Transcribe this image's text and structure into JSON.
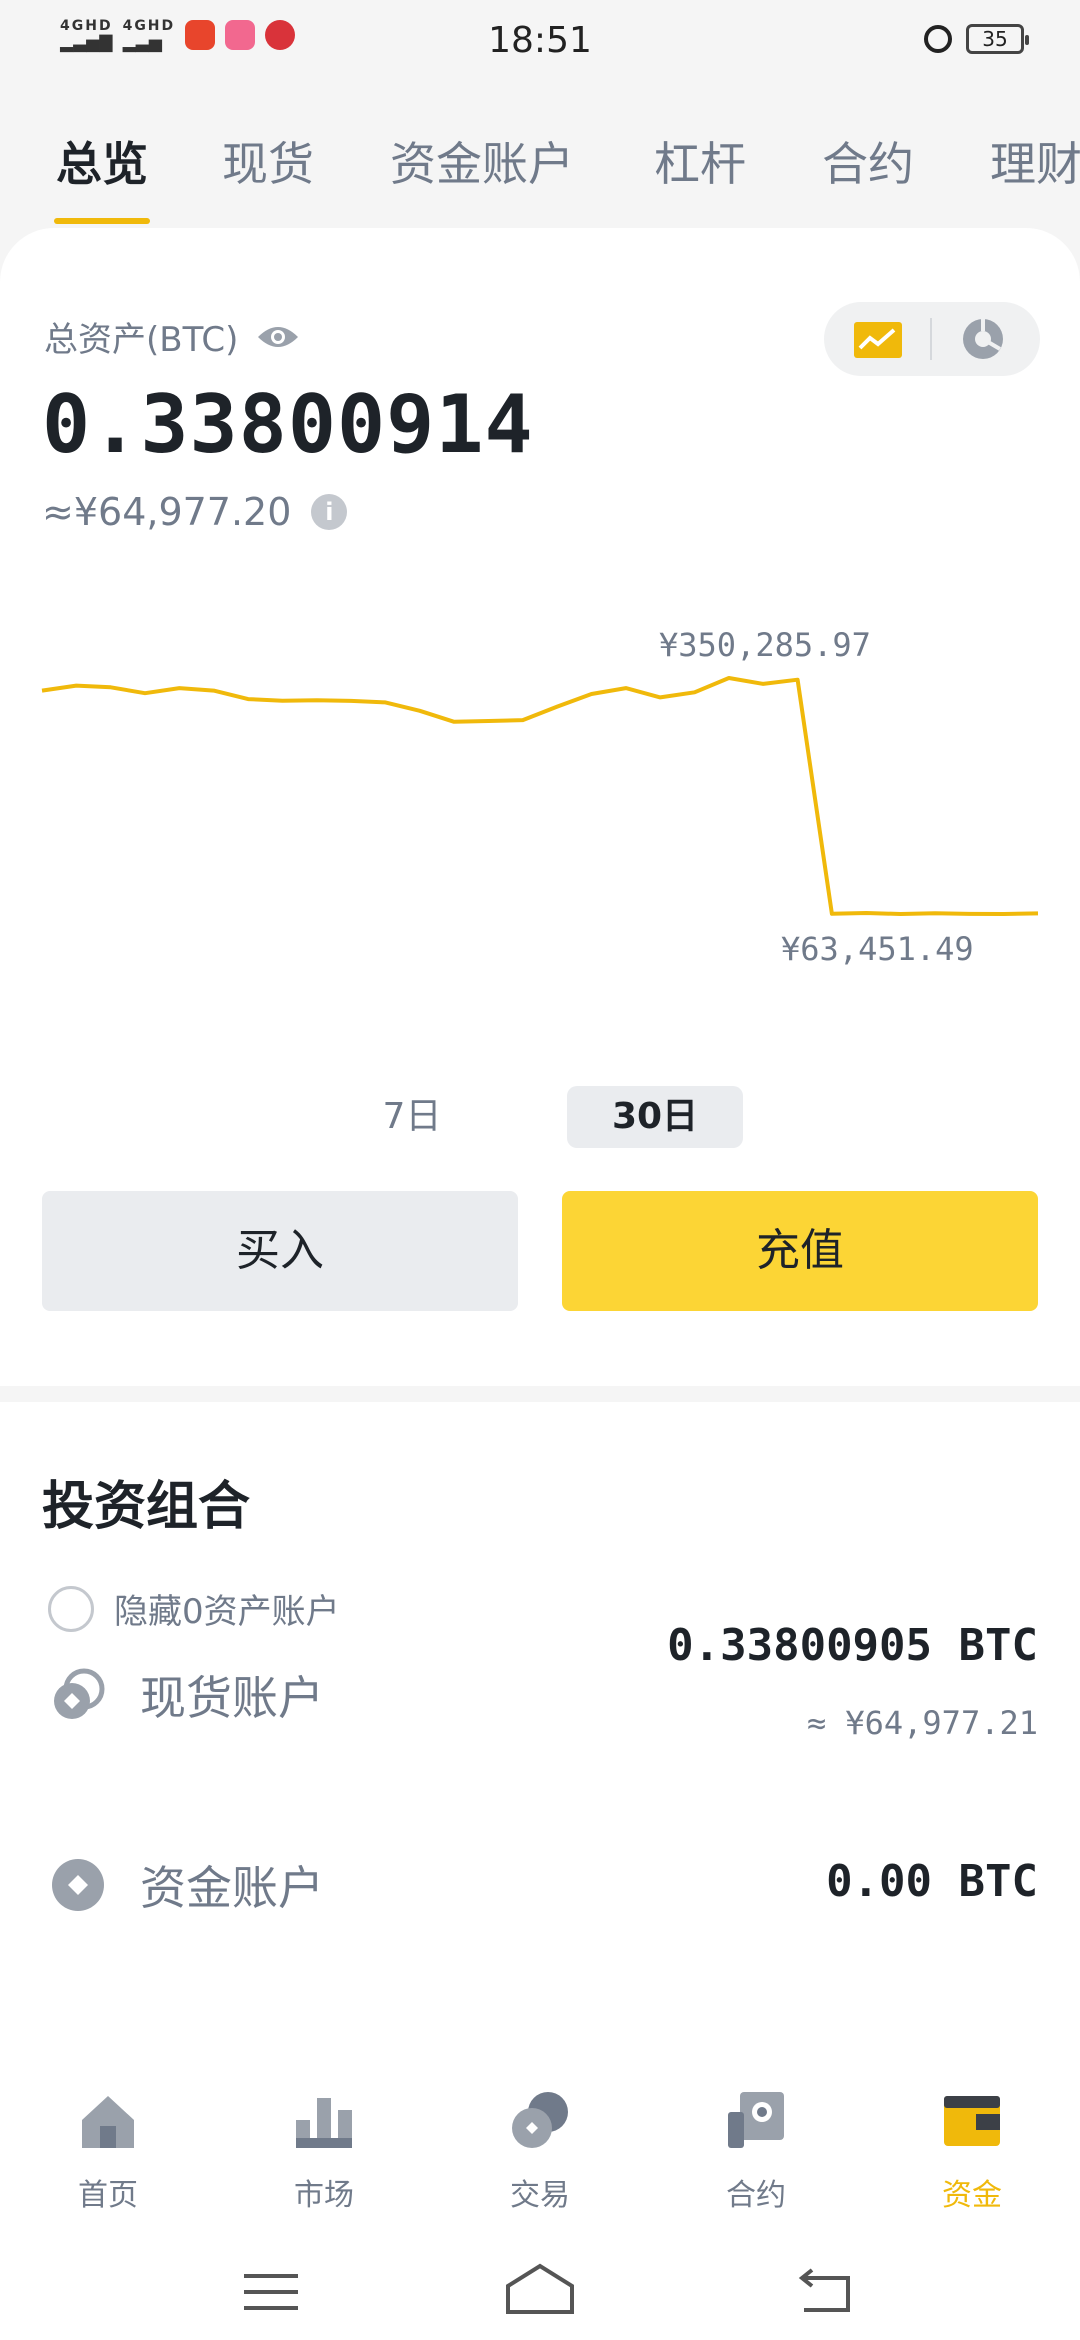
{
  "status": {
    "time": "18:51",
    "battery": "35",
    "signal1": "4GHD",
    "signal2": "4GHD"
  },
  "tabs": [
    "总览",
    "现货",
    "资金账户",
    "杠杆",
    "合约",
    "理财"
  ],
  "overview": {
    "label": "总资产(BTC)",
    "balance": "0.33800914",
    "approx": "≈¥64,977.20"
  },
  "chart_data": {
    "type": "line",
    "max_label": "¥350,285.97",
    "min_label": "¥63,451.49",
    "max_value": 350285.97,
    "min_value": 63451.49,
    "values": [
      331000,
      337000,
      335000,
      328000,
      334000,
      331000,
      321000,
      319000,
      319500,
      318800,
      317000,
      307000,
      294000,
      295000,
      296000,
      312000,
      327000,
      334000,
      323000,
      329000,
      346000,
      339000,
      344000,
      66000,
      67000,
      65800,
      66800,
      65900,
      65800,
      66500
    ],
    "color": "#f0b90b"
  },
  "range": {
    "d7": "7日",
    "d30": "30日"
  },
  "actions": {
    "buy": "买入",
    "deposit": "充值"
  },
  "portfolio": {
    "title": "投资组合",
    "hide_zero": "隐藏0资产账户",
    "accounts": [
      {
        "name": "现货账户",
        "amount": "0.33800905 BTC",
        "approx": "≈ ¥64,977.21"
      },
      {
        "name": "资金账户",
        "amount": "0.00 BTC"
      }
    ]
  },
  "bottom_nav": [
    "首页",
    "市场",
    "交易",
    "合约",
    "资金"
  ]
}
